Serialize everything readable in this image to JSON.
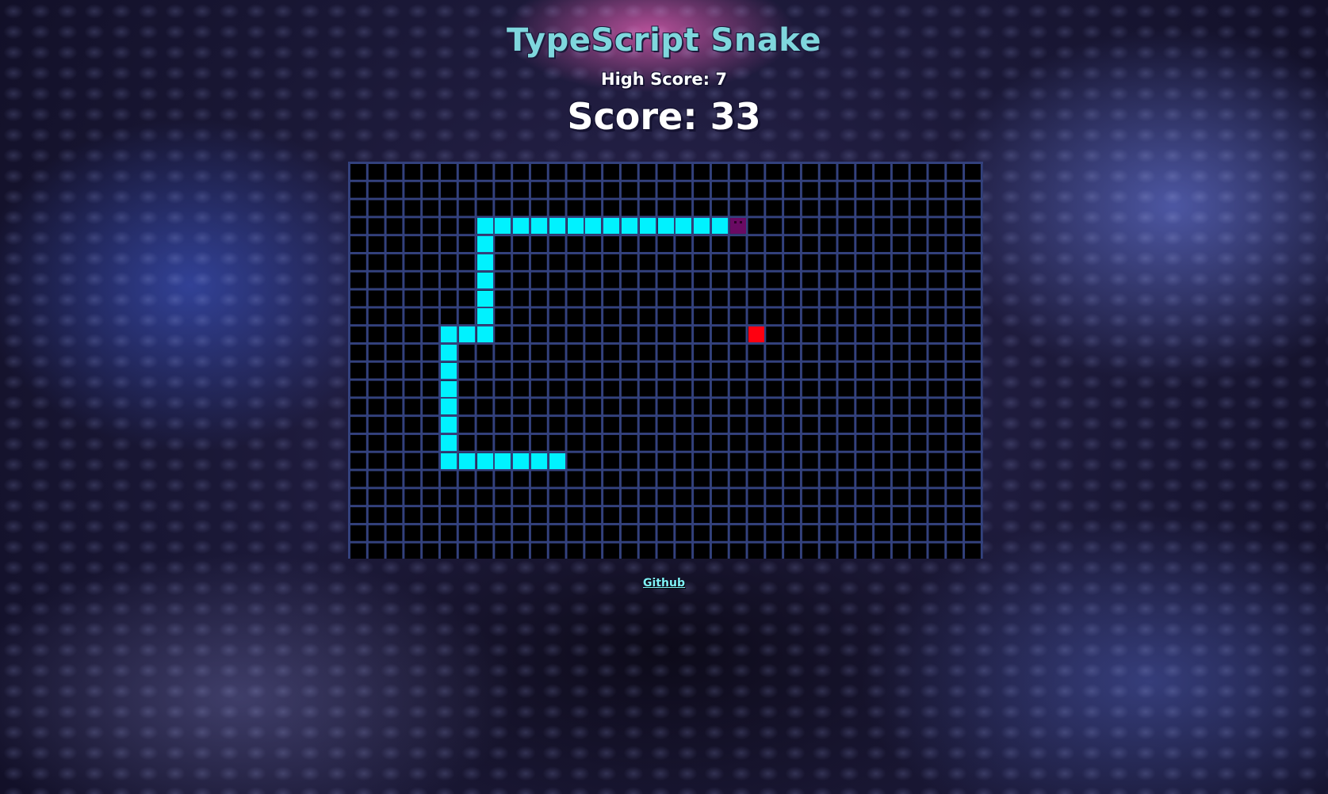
{
  "title": "TypeScript Snake",
  "high_score_text": "High Score: 7",
  "score_text": "Score: 33",
  "github_link": "Github",
  "board": {
    "columns": 35,
    "rows": 22,
    "background_color": "#000000",
    "grid_line_color": "#33417d",
    "snake_color": "#00f2ff",
    "head_color": "#6a0a63",
    "food_color": "#ff0010"
  },
  "snake": {
    "head": [
      21,
      3
    ],
    "body": [
      [
        20,
        3
      ],
      [
        19,
        3
      ],
      [
        18,
        3
      ],
      [
        17,
        3
      ],
      [
        16,
        3
      ],
      [
        15,
        3
      ],
      [
        14,
        3
      ],
      [
        13,
        3
      ],
      [
        12,
        3
      ],
      [
        11,
        3
      ],
      [
        10,
        3
      ],
      [
        9,
        3
      ],
      [
        8,
        3
      ],
      [
        7,
        3
      ],
      [
        7,
        4
      ],
      [
        7,
        5
      ],
      [
        7,
        6
      ],
      [
        7,
        7
      ],
      [
        7,
        8
      ],
      [
        7,
        9
      ],
      [
        6,
        9
      ],
      [
        5,
        9
      ],
      [
        5,
        10
      ],
      [
        5,
        11
      ],
      [
        5,
        12
      ],
      [
        5,
        13
      ],
      [
        5,
        14
      ],
      [
        5,
        15
      ],
      [
        5,
        16
      ],
      [
        6,
        16
      ],
      [
        7,
        16
      ],
      [
        8,
        16
      ],
      [
        9,
        16
      ],
      [
        10,
        16
      ],
      [
        11,
        16
      ]
    ]
  },
  "food": [
    22,
    9
  ]
}
